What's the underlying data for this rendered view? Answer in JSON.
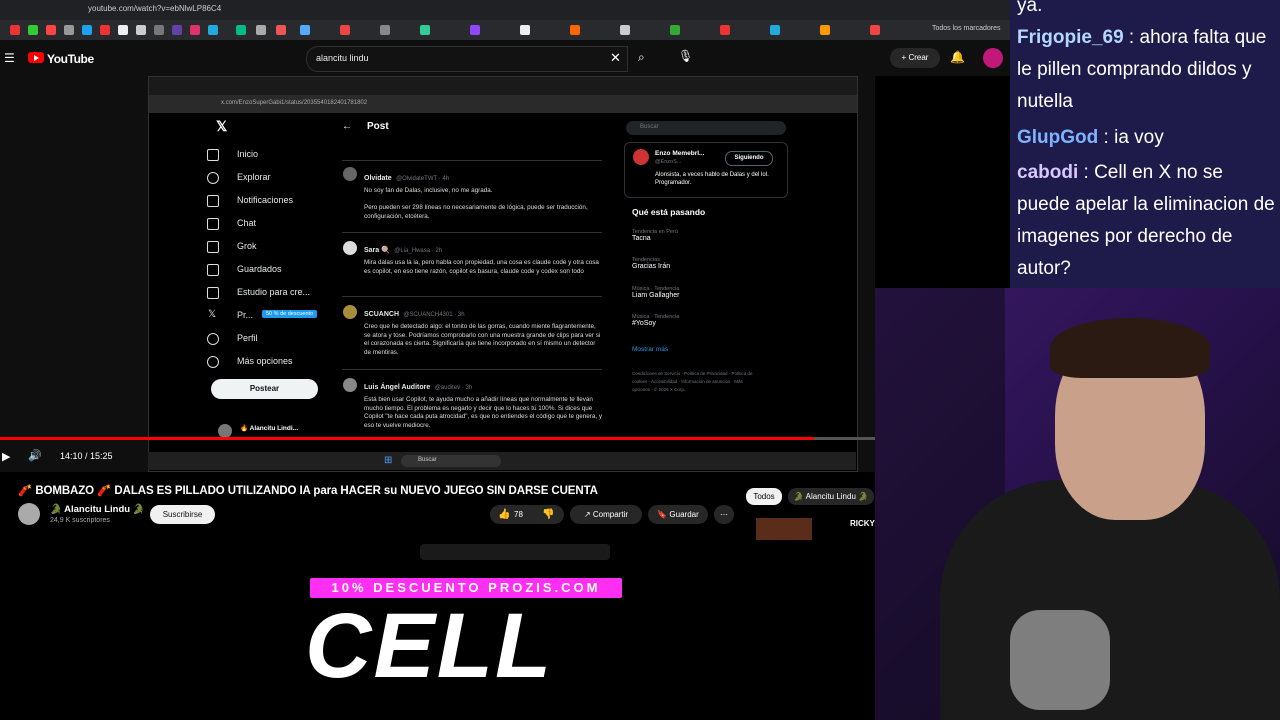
{
  "browser": {
    "url": "youtube.com/watch?v=ebNlwLP86C4",
    "bookmarks_folder": "Todos los marcadores"
  },
  "youtube": {
    "brand": "YouTube",
    "search_value": "alancitu lindu",
    "create_label": "Crear",
    "time_display": "14:10 / 15:25",
    "progress": 0.93,
    "video_title": "🧨 BOMBAZO 🧨 DALAS ES PILLADO UTILIZANDO IA para HACER su NUEVO JUEGO SIN DARSE CUENTA",
    "channel_name": "🐊 Alancitu Lindu 🐊",
    "channel_subs": "24,9 K suscriptores",
    "subscribe_label": "Suscribirse",
    "likes": "78",
    "share_label": "Compartir",
    "save_label": "Guardar",
    "chip_all": "Todos",
    "chip_channel": "🐊 Alancitu Lindu 🐊",
    "sidebar_video_text": "RICKY DALAS"
  },
  "x_page": {
    "url": "x.com/EnzoSuperGabi1/status/2035540182401781802",
    "header": "Post",
    "nav": [
      "Inicio",
      "Explorar",
      "Notificaciones",
      "Chat",
      "Grok",
      "Guardados",
      "Estudio para cre...",
      "Pr...",
      "Perfil",
      "Más opciones"
    ],
    "premium_badge": "50 % de descuento",
    "post_button": "Postear",
    "account_name": "🔥 Alancitu Lindi...",
    "search_placeholder": "Buscar",
    "tweets": [
      {
        "name": "Olvidate",
        "handle": "@OlvidateTWT · 4h",
        "text": "No soy fan de Dalas, inclusive, no me agrada.\n\nPero pueden ser 298 líneas no necesariamente de lógica, puede ser traducción, configuración, etcétera."
      },
      {
        "name": "Sara 🍭",
        "handle": "@Lia_Hwasa · 2h",
        "text": "Mira dalas usa la ia, pero habla con propiedad, una cosa es claude code y otra cosa es copilot, en eso tiene razón, copilot es basura, claude code y codex son todo"
      },
      {
        "name": "SCUANCH",
        "handle": "@SCUANCH4301 · 3h",
        "text": "Creo que he detectado algo: el tonito de las gorras, cuando miente flagrantemente, se atora y tose. Podríamos comprobarlo con una muestra grande de clips para ver si el corazonada es cierta. Significaría que tiene incorporado en sí mismo un detector de mentiras."
      },
      {
        "name": "Luis Ángel Auditore",
        "handle": "@auditev · 3h",
        "text": "Está bien usar Copilot, te ayuda mucho a añadir líneas que normalmente te llevan mucho tiempo. El problema es negarlo y decir que lo haces tú 100%. Si dices que Copilot \"te hace cada puta atrocidad\", es que no entiendes el código que te genera, y eso te vuelve mediocre."
      }
    ],
    "profile_card": {
      "name": "Enzo Memebrl...",
      "handle": "@EnzoS...",
      "follow_label": "Siguiendo",
      "bio": "Alonsista, a veces hablo de Dalas y del lol. Programador."
    },
    "trends_title": "Qué está pasando",
    "trends": [
      {
        "category": "Tendencia en Perú",
        "name": "Tacna"
      },
      {
        "category": "Tendencias",
        "name": "Gracias Irán"
      },
      {
        "category": "Música · Tendencia",
        "name": "Liam Gallagher"
      },
      {
        "category": "Música · Tendencia",
        "name": "#YoSoy"
      }
    ],
    "show_more": "Mostrar más",
    "footer": "Condiciones de Servicio · Política de Privacidad · Política de cookies · Accesibilidad · Información de anuncios · Más opciones · © 2026 X Corp.",
    "taskbar_search": "Buscar"
  },
  "promo": {
    "discount": "10% DESCUENTO PROZIS.COM",
    "code": "CELL"
  },
  "chat": [
    {
      "user": "",
      "message": "ya."
    },
    {
      "user": "Frigopie_69",
      "message": "ahora falta que le pillen comprando dildos y nutella",
      "color": "#b4d7ff"
    },
    {
      "user": "GlupGod",
      "message": "ia voy",
      "color": "#7fb3ff"
    },
    {
      "user": "cabodi",
      "message": "Cell en X no se puede apelar la eliminacion de imagenes por derecho de autor?",
      "color": "#d9c7ff"
    }
  ]
}
